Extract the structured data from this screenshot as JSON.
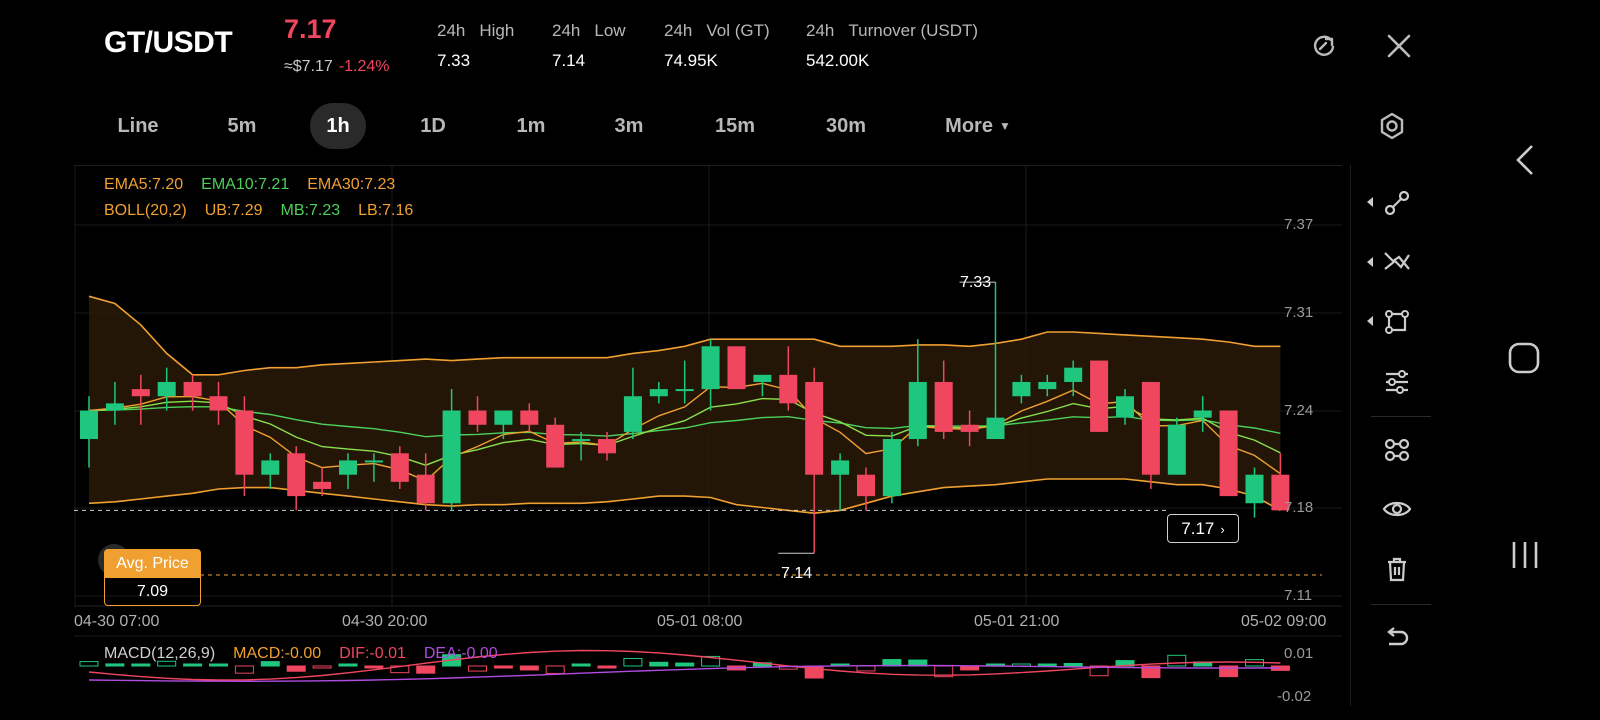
{
  "header": {
    "pair": "GT/USDT",
    "last_price": "7.17",
    "usd_price": "≈$7.17",
    "change": "-1.24%",
    "stats": [
      {
        "period": "24h",
        "label": "High",
        "value": "7.33"
      },
      {
        "period": "24h",
        "label": "Low",
        "value": "7.14"
      },
      {
        "period": "24h",
        "label": "Vol (GT)",
        "value": "74.95K"
      },
      {
        "period": "24h",
        "label": "Turnover (USDT)",
        "value": "542.00K"
      }
    ],
    "refresh_icon": "refresh-icon",
    "close_icon": "close-icon"
  },
  "timeframes": {
    "items": [
      "Line",
      "5m",
      "1h",
      "1D",
      "1m",
      "3m",
      "15m",
      "30m",
      "More"
    ],
    "active": "1h"
  },
  "indicators": {
    "ema": [
      {
        "text": "EMA5:7.20",
        "color": "#f0a030"
      },
      {
        "text": "EMA10:7.21",
        "color": "#4cd05a"
      },
      {
        "text": "EMA30:7.23",
        "color": "#f0a030"
      }
    ],
    "boll": [
      {
        "text": "BOLL(20,2)",
        "color": "#f0a030"
      },
      {
        "text": "UB:7.29",
        "color": "#f0a030"
      },
      {
        "text": "MB:7.23",
        "color": "#4cd05a"
      },
      {
        "text": "LB:7.16",
        "color": "#f0a030"
      }
    ],
    "macd": [
      {
        "text": "MACD(12,26,9)",
        "color": "#cfcfcf"
      },
      {
        "text": "MACD:-0.00",
        "color": "#f0a030"
      },
      {
        "text": "DIF:-0.01",
        "color": "#f0465f"
      },
      {
        "text": "DEA:-0.00",
        "color": "#b04ce0"
      }
    ]
  },
  "chart_data": {
    "type": "candlestick",
    "y_ticks": [
      "7.37",
      "7.31",
      "7.24",
      "7.18",
      "7.11"
    ],
    "ylim": [
      7.11,
      7.37
    ],
    "x_ticks": [
      "04-30 07:00",
      "04-30 20:00",
      "05-01 08:00",
      "05-01 21:00",
      "05-02 09:00"
    ],
    "candles": [
      {
        "o": 7.22,
        "h": 7.25,
        "l": 7.2,
        "c": 7.24
      },
      {
        "o": 7.24,
        "h": 7.26,
        "l": 7.23,
        "c": 7.245
      },
      {
        "o": 7.255,
        "h": 7.265,
        "l": 7.23,
        "c": 7.25
      },
      {
        "o": 7.25,
        "h": 7.27,
        "l": 7.24,
        "c": 7.26
      },
      {
        "o": 7.26,
        "h": 7.265,
        "l": 7.24,
        "c": 7.25
      },
      {
        "o": 7.25,
        "h": 7.26,
        "l": 7.23,
        "c": 7.24
      },
      {
        "o": 7.24,
        "h": 7.25,
        "l": 7.18,
        "c": 7.195
      },
      {
        "o": 7.195,
        "h": 7.21,
        "l": 7.185,
        "c": 7.205
      },
      {
        "o": 7.21,
        "h": 7.215,
        "l": 7.17,
        "c": 7.18
      },
      {
        "o": 7.19,
        "h": 7.2,
        "l": 7.18,
        "c": 7.185
      },
      {
        "o": 7.195,
        "h": 7.21,
        "l": 7.185,
        "c": 7.205
      },
      {
        "o": 7.205,
        "h": 7.21,
        "l": 7.19,
        "c": 7.205
      },
      {
        "o": 7.21,
        "h": 7.215,
        "l": 7.185,
        "c": 7.19
      },
      {
        "o": 7.195,
        "h": 7.21,
        "l": 7.17,
        "c": 7.175
      },
      {
        "o": 7.175,
        "h": 7.255,
        "l": 7.17,
        "c": 7.24
      },
      {
        "o": 7.24,
        "h": 7.25,
        "l": 7.225,
        "c": 7.23
      },
      {
        "o": 7.23,
        "h": 7.24,
        "l": 7.22,
        "c": 7.24
      },
      {
        "o": 7.24,
        "h": 7.245,
        "l": 7.225,
        "c": 7.23
      },
      {
        "o": 7.23,
        "h": 7.235,
        "l": 7.2,
        "c": 7.2
      },
      {
        "o": 7.22,
        "h": 7.225,
        "l": 7.205,
        "c": 7.22
      },
      {
        "o": 7.22,
        "h": 7.225,
        "l": 7.205,
        "c": 7.21
      },
      {
        "o": 7.225,
        "h": 7.27,
        "l": 7.22,
        "c": 7.25
      },
      {
        "o": 7.25,
        "h": 7.26,
        "l": 7.245,
        "c": 7.255
      },
      {
        "o": 7.255,
        "h": 7.275,
        "l": 7.245,
        "c": 7.255
      },
      {
        "o": 7.255,
        "h": 7.29,
        "l": 7.24,
        "c": 7.285
      },
      {
        "o": 7.285,
        "h": 7.285,
        "l": 7.255,
        "c": 7.255
      },
      {
        "o": 7.26,
        "h": 7.265,
        "l": 7.25,
        "c": 7.265
      },
      {
        "o": 7.265,
        "h": 7.285,
        "l": 7.24,
        "c": 7.245
      },
      {
        "o": 7.26,
        "h": 7.27,
        "l": 7.14,
        "c": 7.195
      },
      {
        "o": 7.195,
        "h": 7.21,
        "l": 7.17,
        "c": 7.205
      },
      {
        "o": 7.195,
        "h": 7.2,
        "l": 7.17,
        "c": 7.18
      },
      {
        "o": 7.18,
        "h": 7.225,
        "l": 7.175,
        "c": 7.22
      },
      {
        "o": 7.22,
        "h": 7.29,
        "l": 7.215,
        "c": 7.26
      },
      {
        "o": 7.26,
        "h": 7.275,
        "l": 7.22,
        "c": 7.225
      },
      {
        "o": 7.23,
        "h": 7.24,
        "l": 7.215,
        "c": 7.225
      },
      {
        "o": 7.22,
        "h": 7.33,
        "l": 7.22,
        "c": 7.235
      },
      {
        "o": 7.25,
        "h": 7.265,
        "l": 7.245,
        "c": 7.26
      },
      {
        "o": 7.255,
        "h": 7.265,
        "l": 7.25,
        "c": 7.26
      },
      {
        "o": 7.26,
        "h": 7.275,
        "l": 7.25,
        "c": 7.27
      },
      {
        "o": 7.275,
        "h": 7.275,
        "l": 7.225,
        "c": 7.225
      },
      {
        "o": 7.235,
        "h": 7.255,
        "l": 7.23,
        "c": 7.25
      },
      {
        "o": 7.26,
        "h": 7.26,
        "l": 7.185,
        "c": 7.195
      },
      {
        "o": 7.195,
        "h": 7.235,
        "l": 7.195,
        "c": 7.23
      },
      {
        "o": 7.235,
        "h": 7.25,
        "l": 7.225,
        "c": 7.24
      },
      {
        "o": 7.24,
        "h": 7.24,
        "l": 7.18,
        "c": 7.18
      },
      {
        "o": 7.175,
        "h": 7.2,
        "l": 7.165,
        "c": 7.195
      },
      {
        "o": 7.195,
        "h": 7.21,
        "l": 7.18,
        "c": 7.17
      }
    ],
    "high_label": "7.33",
    "low_label": "7.14",
    "current_price": "7.17",
    "macd_ticks": [
      "0.01",
      "-0.02"
    ]
  },
  "avg_price": {
    "label": "Avg. Price",
    "value": "7.09"
  },
  "sidebar_icons": [
    "draw-line-icon",
    "trend-lines-icon",
    "shapes-icon",
    "indicator-settings-icon",
    "multi-indicator-icon",
    "visibility-icon",
    "delete-icon",
    "undo-icon"
  ],
  "system_nav": [
    "back-icon",
    "home-icon",
    "recent-apps-icon"
  ]
}
